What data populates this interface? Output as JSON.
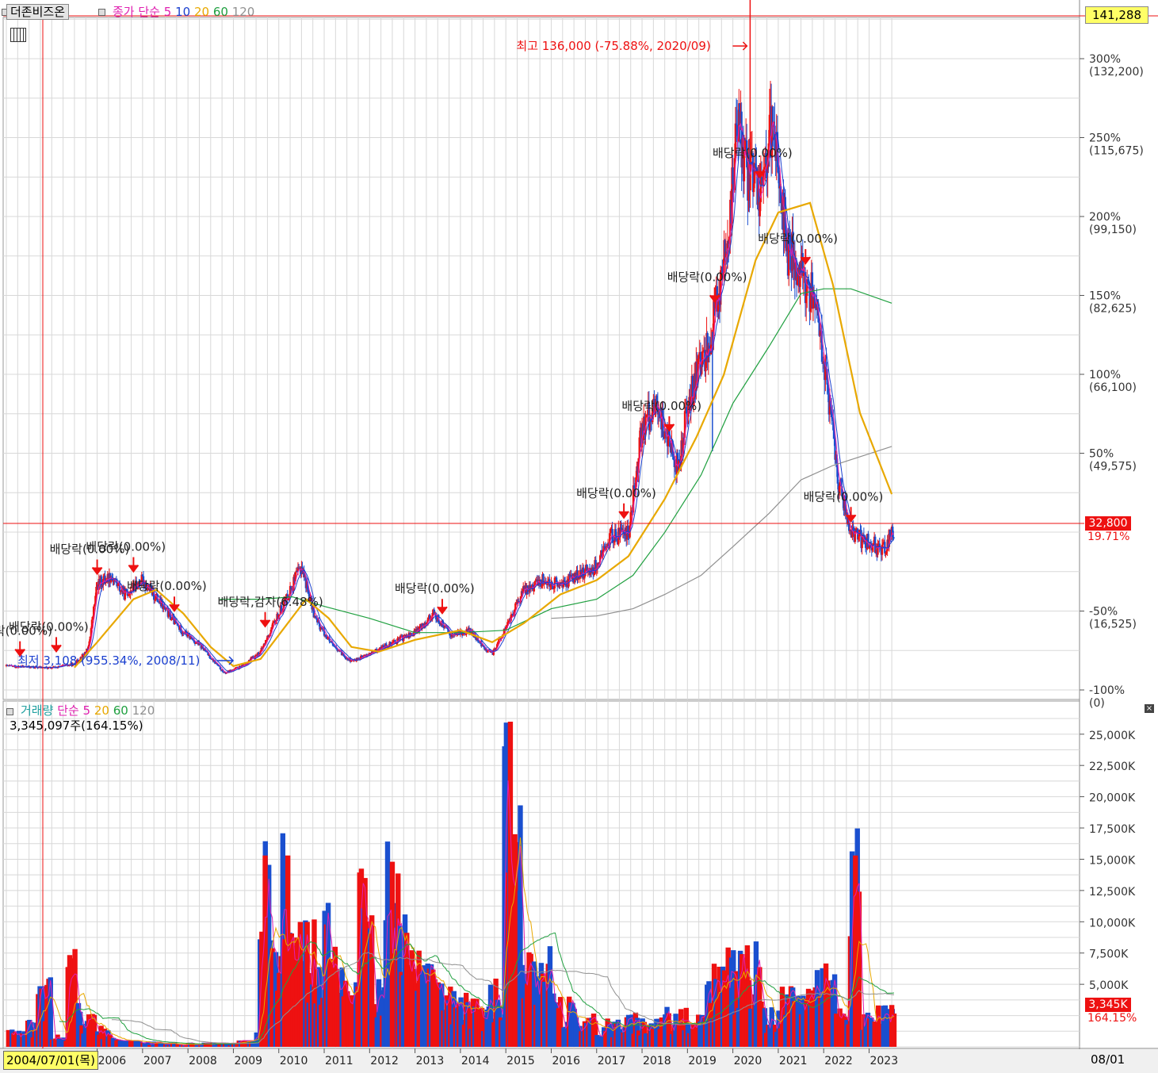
{
  "header": {
    "stock_name": "더존비즈온",
    "indicator_label": "종가 단순",
    "ma_periods": [
      "5",
      "10",
      "20",
      "60",
      "120"
    ],
    "last_price_box": "141,288"
  },
  "volume_header": {
    "label": "거래량",
    "ma_label": "단순 5",
    "ma_periods": [
      "20",
      "60",
      "120"
    ],
    "value": "3,345,097주(164.15%)"
  },
  "colors": {
    "up": "#ee1111",
    "down": "#1a4fcf",
    "ma5": "#e020b0",
    "ma10": "#1a3fcf",
    "ma20": "#e8a800",
    "ma60": "#20a040",
    "ma120": "#909090",
    "crosshair": "#ee1111",
    "grid": "#d8d8d8"
  },
  "price_axis": {
    "ticks": [
      {
        "pct": "300%",
        "price": "(132,200)",
        "value": 132200
      },
      {
        "pct": "250%",
        "price": "(115,675)",
        "value": 115675
      },
      {
        "pct": "200%",
        "price": "(99,150)",
        "value": 99150
      },
      {
        "pct": "150%",
        "price": "(82,625)",
        "value": 82625
      },
      {
        "pct": "100%",
        "price": "(66,100)",
        "value": 66100
      },
      {
        "pct": "50%",
        "price": "(49,575)",
        "value": 49575
      },
      {
        "pct": "-50%",
        "price": "(16,525)",
        "value": 16525
      },
      {
        "pct": "-100%",
        "price": "(0)",
        "value": 0
      }
    ],
    "current_price": "32,800",
    "current_pct": "19.71%"
  },
  "volume_axis": {
    "ticks": [
      "25,000K",
      "22,500K",
      "20,000K",
      "17,500K",
      "15,000K",
      "12,500K",
      "10,000K",
      "7,500K",
      "5,000K"
    ],
    "current_volume": "3,345K",
    "current_pct": "164.15%"
  },
  "x_axis": {
    "cursor_date": "2004/07/01(목)",
    "years": [
      "2006",
      "2007",
      "2008",
      "2009",
      "2010",
      "2011",
      "2012",
      "2013",
      "2014",
      "2015",
      "2016",
      "2017",
      "2018",
      "2019",
      "2020",
      "2021",
      "2022",
      "2023"
    ],
    "right_label": "08/01"
  },
  "annotations": {
    "high": "최고 136,000 (-75.88%, 2020/09)",
    "low": "최저 3,108 (955.34%, 2008/11)",
    "dividends": [
      {
        "text": "배당락(0.00%)",
        "year": 2004.3
      },
      {
        "text": "배당락(0.00%)",
        "year": 2005.1
      },
      {
        "text": "배당락(0.00%)",
        "year": 2006.0
      },
      {
        "text": "배당락(0.00%)",
        "year": 2006.8
      },
      {
        "text": "배당락(0.00%)",
        "year": 2007.7
      },
      {
        "text": "배당락,감자(6.48%)",
        "year": 2009.7
      },
      {
        "text": "배당락(0.00%)",
        "year": 2013.6
      },
      {
        "text": "배당락(0.00%)",
        "year": 2017.6
      },
      {
        "text": "배당락(0.00%)",
        "year": 2018.6
      },
      {
        "text": "배당락(0.00%)",
        "year": 2019.6
      },
      {
        "text": "배당락(0.00%)",
        "year": 2020.6
      },
      {
        "text": "배당락(0.00%)",
        "year": 2021.6
      },
      {
        "text": "배당락(0.00%)",
        "year": 2022.6
      }
    ]
  },
  "chart_data": [
    {
      "type": "candlestick",
      "title": "더존비즈온",
      "x_unit": "year",
      "ylim": [
        0,
        160000
      ],
      "price_path": [
        {
          "x": 2004.0,
          "y": 5000
        },
        {
          "x": 2004.5,
          "y": 4800
        },
        {
          "x": 2005.0,
          "y": 4600
        },
        {
          "x": 2005.5,
          "y": 5400
        },
        {
          "x": 2005.8,
          "y": 8500
        },
        {
          "x": 2006.0,
          "y": 22000
        },
        {
          "x": 2006.3,
          "y": 24000
        },
        {
          "x": 2006.6,
          "y": 20000
        },
        {
          "x": 2007.0,
          "y": 23000
        },
        {
          "x": 2007.4,
          "y": 18000
        },
        {
          "x": 2007.8,
          "y": 13000
        },
        {
          "x": 2008.3,
          "y": 9000
        },
        {
          "x": 2008.8,
          "y": 3500
        },
        {
          "x": 2009.2,
          "y": 5000
        },
        {
          "x": 2009.6,
          "y": 8000
        },
        {
          "x": 2009.9,
          "y": 14000
        },
        {
          "x": 2010.2,
          "y": 20000
        },
        {
          "x": 2010.5,
          "y": 26000
        },
        {
          "x": 2010.8,
          "y": 15000
        },
        {
          "x": 2011.2,
          "y": 9000
        },
        {
          "x": 2011.6,
          "y": 6000
        },
        {
          "x": 2012.0,
          "y": 7500
        },
        {
          "x": 2012.5,
          "y": 10000
        },
        {
          "x": 2013.0,
          "y": 12000
        },
        {
          "x": 2013.4,
          "y": 16000
        },
        {
          "x": 2013.8,
          "y": 11500
        },
        {
          "x": 2014.2,
          "y": 12500
        },
        {
          "x": 2014.5,
          "y": 9000
        },
        {
          "x": 2014.7,
          "y": 7500
        },
        {
          "x": 2015.0,
          "y": 13000
        },
        {
          "x": 2015.4,
          "y": 21000
        },
        {
          "x": 2015.8,
          "y": 23000
        },
        {
          "x": 2016.2,
          "y": 22000
        },
        {
          "x": 2016.6,
          "y": 24000
        },
        {
          "x": 2017.0,
          "y": 26000
        },
        {
          "x": 2017.3,
          "y": 32000
        },
        {
          "x": 2017.7,
          "y": 33000
        },
        {
          "x": 2018.0,
          "y": 55000
        },
        {
          "x": 2018.3,
          "y": 60000
        },
        {
          "x": 2018.6,
          "y": 52000
        },
        {
          "x": 2018.8,
          "y": 46000
        },
        {
          "x": 2019.0,
          "y": 60000
        },
        {
          "x": 2019.3,
          "y": 68000
        },
        {
          "x": 2019.6,
          "y": 78000
        },
        {
          "x": 2019.9,
          "y": 95000
        },
        {
          "x": 2020.1,
          "y": 118000
        },
        {
          "x": 2020.3,
          "y": 108000
        },
        {
          "x": 2020.6,
          "y": 105000
        },
        {
          "x": 2020.9,
          "y": 120000
        },
        {
          "x": 2021.2,
          "y": 92000
        },
        {
          "x": 2021.5,
          "y": 88000
        },
        {
          "x": 2021.8,
          "y": 82000
        },
        {
          "x": 2022.0,
          "y": 70000
        },
        {
          "x": 2022.3,
          "y": 45000
        },
        {
          "x": 2022.6,
          "y": 33000
        },
        {
          "x": 2022.9,
          "y": 31000
        },
        {
          "x": 2023.1,
          "y": 30500
        },
        {
          "x": 2023.3,
          "y": 29000
        },
        {
          "x": 2023.5,
          "y": 32800
        }
      ],
      "ma20": [
        {
          "x": 2005.5,
          "y": 4700
        },
        {
          "x": 2006.0,
          "y": 10000
        },
        {
          "x": 2006.8,
          "y": 19000
        },
        {
          "x": 2007.3,
          "y": 21000
        },
        {
          "x": 2007.9,
          "y": 16000
        },
        {
          "x": 2008.5,
          "y": 9000
        },
        {
          "x": 2009.0,
          "y": 5000
        },
        {
          "x": 2009.6,
          "y": 6500
        },
        {
          "x": 2010.2,
          "y": 14000
        },
        {
          "x": 2010.6,
          "y": 19000
        },
        {
          "x": 2011.1,
          "y": 15000
        },
        {
          "x": 2011.6,
          "y": 9000
        },
        {
          "x": 2012.2,
          "y": 8000
        },
        {
          "x": 2013.0,
          "y": 10500
        },
        {
          "x": 2014.0,
          "y": 12500
        },
        {
          "x": 2014.7,
          "y": 10000
        },
        {
          "x": 2015.4,
          "y": 14000
        },
        {
          "x": 2016.2,
          "y": 20000
        },
        {
          "x": 2017.0,
          "y": 23000
        },
        {
          "x": 2017.7,
          "y": 28000
        },
        {
          "x": 2018.5,
          "y": 40000
        },
        {
          "x": 2019.2,
          "y": 53000
        },
        {
          "x": 2019.8,
          "y": 66000
        },
        {
          "x": 2020.5,
          "y": 90000
        },
        {
          "x": 2021.0,
          "y": 100000
        },
        {
          "x": 2021.7,
          "y": 102000
        },
        {
          "x": 2022.2,
          "y": 85000
        },
        {
          "x": 2022.8,
          "y": 58000
        },
        {
          "x": 2023.5,
          "y": 41000
        }
      ],
      "ma60": [
        {
          "x": 2008.7,
          "y": 19000
        },
        {
          "x": 2009.6,
          "y": 19000
        },
        {
          "x": 2010.3,
          "y": 19500
        },
        {
          "x": 2011.0,
          "y": 17500
        },
        {
          "x": 2012.0,
          "y": 15000
        },
        {
          "x": 2013.0,
          "y": 12000
        },
        {
          "x": 2014.0,
          "y": 12000
        },
        {
          "x": 2015.0,
          "y": 12500
        },
        {
          "x": 2016.0,
          "y": 17000
        },
        {
          "x": 2017.0,
          "y": 19000
        },
        {
          "x": 2017.8,
          "y": 24000
        },
        {
          "x": 2018.5,
          "y": 33000
        },
        {
          "x": 2019.3,
          "y": 45000
        },
        {
          "x": 2020.0,
          "y": 60000
        },
        {
          "x": 2020.8,
          "y": 72000
        },
        {
          "x": 2021.5,
          "y": 83000
        },
        {
          "x": 2022.0,
          "y": 84000
        },
        {
          "x": 2022.6,
          "y": 84000
        },
        {
          "x": 2023.5,
          "y": 81000
        }
      ],
      "ma120": [
        {
          "x": 2016.0,
          "y": 15000
        },
        {
          "x": 2017.0,
          "y": 15500
        },
        {
          "x": 2017.8,
          "y": 17000
        },
        {
          "x": 2018.5,
          "y": 20000
        },
        {
          "x": 2019.3,
          "y": 24000
        },
        {
          "x": 2020.0,
          "y": 30000
        },
        {
          "x": 2020.8,
          "y": 37000
        },
        {
          "x": 2021.5,
          "y": 44000
        },
        {
          "x": 2022.2,
          "y": 47000
        },
        {
          "x": 2023.5,
          "y": 51000
        }
      ]
    },
    {
      "type": "bar",
      "title": "거래량",
      "x_unit": "year",
      "ylim": [
        0,
        27000
      ],
      "y_unit": "K",
      "bars": [
        {
          "x": 2004.3,
          "v": 1200
        },
        {
          "x": 2004.6,
          "v": 2000
        },
        {
          "x": 2004.8,
          "v": 5500
        },
        {
          "x": 2005.2,
          "v": 1000
        },
        {
          "x": 2005.5,
          "v": 6800
        },
        {
          "x": 2005.8,
          "v": 2500
        },
        {
          "x": 2006.1,
          "v": 1500
        },
        {
          "x": 2006.6,
          "v": 800
        },
        {
          "x": 2007.2,
          "v": 400
        },
        {
          "x": 2008.0,
          "v": 300
        },
        {
          "x": 2008.8,
          "v": 300
        },
        {
          "x": 2009.4,
          "v": 1500
        },
        {
          "x": 2009.7,
          "v": 15300
        },
        {
          "x": 2009.9,
          "v": 7500
        },
        {
          "x": 2010.2,
          "v": 15300
        },
        {
          "x": 2010.5,
          "v": 11000
        },
        {
          "x": 2010.8,
          "v": 9000
        },
        {
          "x": 2011.1,
          "v": 11000
        },
        {
          "x": 2011.5,
          "v": 6000
        },
        {
          "x": 2011.9,
          "v": 13500
        },
        {
          "x": 2012.2,
          "v": 6500
        },
        {
          "x": 2012.5,
          "v": 14800
        },
        {
          "x": 2012.9,
          "v": 10000
        },
        {
          "x": 2013.3,
          "v": 6000
        },
        {
          "x": 2013.7,
          "v": 5000
        },
        {
          "x": 2014.0,
          "v": 4500
        },
        {
          "x": 2014.4,
          "v": 3500
        },
        {
          "x": 2014.8,
          "v": 5000
        },
        {
          "x": 2015.1,
          "v": 26000
        },
        {
          "x": 2015.2,
          "v": 17000
        },
        {
          "x": 2015.5,
          "v": 7000
        },
        {
          "x": 2015.9,
          "v": 7000
        },
        {
          "x": 2016.3,
          "v": 3500
        },
        {
          "x": 2016.8,
          "v": 2500
        },
        {
          "x": 2017.2,
          "v": 2000
        },
        {
          "x": 2017.6,
          "v": 2500
        },
        {
          "x": 2018.0,
          "v": 2500
        },
        {
          "x": 2018.6,
          "v": 2800
        },
        {
          "x": 2019.2,
          "v": 2800
        },
        {
          "x": 2019.6,
          "v": 6000
        },
        {
          "x": 2020.1,
          "v": 7000
        },
        {
          "x": 2020.5,
          "v": 7600
        },
        {
          "x": 2020.8,
          "v": 3000
        },
        {
          "x": 2021.3,
          "v": 4500
        },
        {
          "x": 2021.7,
          "v": 5500
        },
        {
          "x": 2022.1,
          "v": 6000
        },
        {
          "x": 2022.4,
          "v": 3000
        },
        {
          "x": 2022.7,
          "v": 15300
        },
        {
          "x": 2022.9,
          "v": 2500
        },
        {
          "x": 2023.2,
          "v": 3000
        },
        {
          "x": 2023.5,
          "v": 3345
        }
      ]
    }
  ]
}
